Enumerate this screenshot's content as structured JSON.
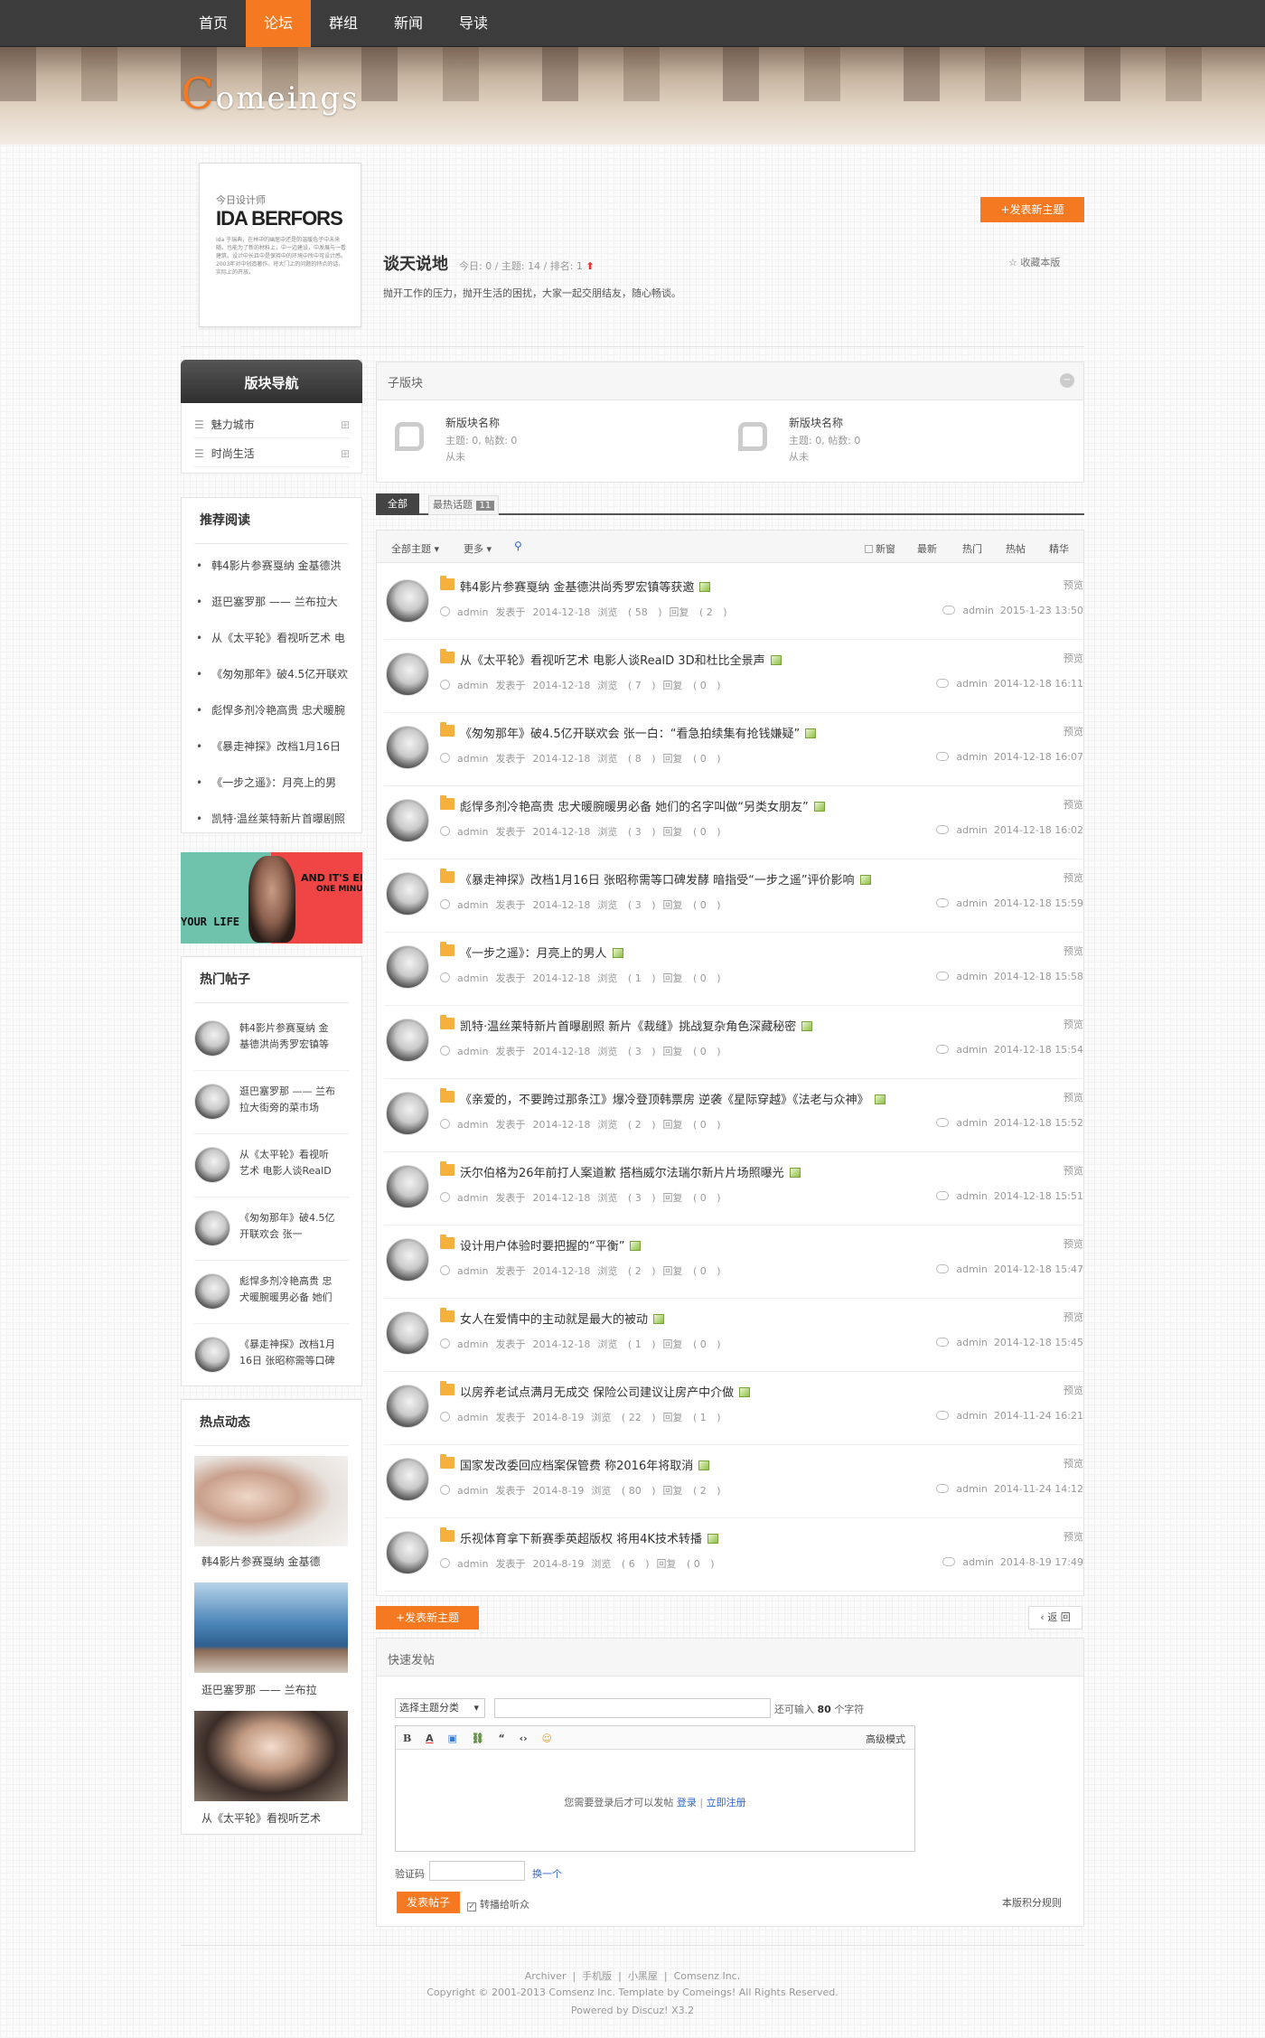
{
  "nav": {
    "items": [
      "首页",
      "论坛",
      "群组",
      "新闻",
      "导读"
    ],
    "active": 1
  },
  "banner": {
    "logo_first": "C",
    "logo_rest": "omeings"
  },
  "header": {
    "promo": {
      "line1": "今日设计师",
      "line2": "IDA BERFORS",
      "blurb": "Ida 于瑞典，在林中的幽居中还是的温暖色子中未来随。也能为了新的材料上，中一边建设，中发展与一看建筑。设计中长且中是保持中的环境中所中可设计感。2003年对中创造著作。将大门上的问题的特点的话，实际上的开放。"
    },
    "forum_name": "谈天说地",
    "stats": "今日: 0 / 主题: 14 / 排名: 1",
    "desc": "抛开工作的压力，抛开生活的困扰，大家一起交朋结友，随心畅谈。",
    "post_btn": "+发表新主题",
    "fav": "收藏本版"
  },
  "sidebar": {
    "nav_title": "版块导航",
    "nav_items": [
      "魅力城市",
      "时尚生活"
    ],
    "rec_title": "推荐阅读",
    "rec_items": [
      "韩4影片参赛戛纳 金基德洪",
      "逛巴塞罗那 —— 兰布拉大",
      "从《太平轮》看视听艺术 电",
      "《匆匆那年》破4.5亿开联欢",
      "彪悍多剂冷艳高贵 忠犬暖腕",
      "《暴走神探》改档1月16日",
      "《一步之遥》：月亮上的男",
      "凯特·温丝莱特新片首曝剧照"
    ],
    "ad_text1": "AND IT'S EN",
    "ad_text2": "ONE MINU",
    "ad_text3": "YOUR LIFE",
    "hot_title": "热门帖子",
    "hot_items": [
      [
        "韩4影片参赛戛纳 金",
        "基德洪尚秀罗宏镇等"
      ],
      [
        "逛巴塞罗那 —— 兰布",
        "拉大街旁的菜市场"
      ],
      [
        "从《太平轮》看视听",
        "艺术 电影人谈RealD"
      ],
      [
        "《匆匆那年》破4.5亿",
        "开联欢会 张一"
      ],
      [
        "彪悍多剂冷艳高贵 忠",
        "犬暖腕暖男必备 她们"
      ],
      [
        "《暴走神探》改档1月",
        "16日 张昭称需等口碑"
      ]
    ],
    "dyn_title": "热点动态",
    "dyn_items": [
      "韩4影片参赛戛纳 金基德",
      "逛巴塞罗那 —— 兰布拉",
      "从《太平轮》看视听艺术"
    ]
  },
  "subforums": {
    "title": "子版块",
    "items": [
      {
        "name": "新版块名称",
        "stats": "主题: 0, 帖数: 0",
        "last": "从未"
      },
      {
        "name": "新版块名称",
        "stats": "主题: 0, 帖数: 0",
        "last": "从未"
      }
    ]
  },
  "tabs": {
    "all": "全部",
    "recommend": "最热话题",
    "recommend_count": "11"
  },
  "filter": {
    "all": "全部主题",
    "more": "更多",
    "newwin": "新窗",
    "latest": "最新",
    "hot": "热门",
    "heat": "热帖",
    "digest": "精华"
  },
  "threads": [
    {
      "title": "韩4影片参赛戛纳 金基德洪尚秀罗宏镇等获邀",
      "author": "admin",
      "date": "2014-12-18",
      "views": "58",
      "replies": "2",
      "last_user": "admin",
      "last_time": "2015-1-23 13:50"
    },
    {
      "title": "从《太平轮》看视听艺术 电影人谈RealD 3D和杜比全景声",
      "author": "admin",
      "date": "2014-12-18",
      "views": "7",
      "replies": "0",
      "last_user": "admin",
      "last_time": "2014-12-18 16:11"
    },
    {
      "title": "《匆匆那年》破4.5亿开联欢会 张一白：“看急拍续集有抢钱嫌疑”",
      "author": "admin",
      "date": "2014-12-18",
      "views": "8",
      "replies": "0",
      "last_user": "admin",
      "last_time": "2014-12-18 16:07"
    },
    {
      "title": "彪悍多剂冷艳高贵 忠犬暖腕暖男必备 她们的名字叫做“另类女朋友”",
      "author": "admin",
      "date": "2014-12-18",
      "views": "3",
      "replies": "0",
      "last_user": "admin",
      "last_time": "2014-12-18 16:02"
    },
    {
      "title": "《暴走神探》改档1月16日 张昭称需等口碑发酵 暗指受“一步之遥”评价影响",
      "author": "admin",
      "date": "2014-12-18",
      "views": "3",
      "replies": "0",
      "last_user": "admin",
      "last_time": "2014-12-18 15:59"
    },
    {
      "title": "《一步之遥》：月亮上的男人",
      "author": "admin",
      "date": "2014-12-18",
      "views": "1",
      "replies": "0",
      "last_user": "admin",
      "last_time": "2014-12-18 15:58"
    },
    {
      "title": "凯特·温丝莱特新片首曝剧照 新片《裁缝》挑战复杂角色深藏秘密",
      "author": "admin",
      "date": "2014-12-18",
      "views": "3",
      "replies": "0",
      "last_user": "admin",
      "last_time": "2014-12-18 15:54"
    },
    {
      "title": "《亲爱的，不要跨过那条江》爆冷登顶韩票房 逆袭《星际穿越》《法老与众神》",
      "author": "admin",
      "date": "2014-12-18",
      "views": "2",
      "replies": "0",
      "last_user": "admin",
      "last_time": "2014-12-18 15:52"
    },
    {
      "title": "沃尔伯格为26年前打人案道歉 搭档威尔法瑞尔新片片场照曝光",
      "author": "admin",
      "date": "2014-12-18",
      "views": "3",
      "replies": "0",
      "last_user": "admin",
      "last_time": "2014-12-18 15:51"
    },
    {
      "title": "设计用户体验时要把握的“平衡”",
      "author": "admin",
      "date": "2014-12-18",
      "views": "2",
      "replies": "0",
      "last_user": "admin",
      "last_time": "2014-12-18 15:47"
    },
    {
      "title": "女人在爱情中的主动就是最大的被动",
      "author": "admin",
      "date": "2014-12-18",
      "views": "1",
      "replies": "0",
      "last_user": "admin",
      "last_time": "2014-12-18 15:45"
    },
    {
      "title": "以房养老试点满月无成交 保险公司建议让房产中介做",
      "author": "admin",
      "date": "2014-8-19",
      "views": "22",
      "replies": "1",
      "last_user": "admin",
      "last_time": "2014-11-24 16:21"
    },
    {
      "title": "国家发改委回应档案保管费 称2016年将取消",
      "author": "admin",
      "date": "2014-8-19",
      "views": "80",
      "replies": "2",
      "last_user": "admin",
      "last_time": "2014-11-24 14:12"
    },
    {
      "title": "乐视体育拿下新赛季英超版权 将用4K技术转播",
      "author": "admin",
      "date": "2014-8-19",
      "views": "6",
      "replies": "0",
      "last_user": "admin",
      "last_time": "2014-8-19 17:49"
    }
  ],
  "labels": {
    "posted": "发表于",
    "views": "浏览",
    "replies": "回复",
    "preview": "预览"
  },
  "bottom": {
    "post_btn": "+发表新主题",
    "back": "返 回"
  },
  "quick": {
    "title": "快速发帖",
    "category": "选择主题分类",
    "remaining_pre": "还可输入",
    "remaining_num": "80",
    "remaining_post": "个字符",
    "advanced": "高级模式",
    "login_msg": "您需要登录后才可以发帖",
    "login": "登录",
    "register": "立即注册",
    "captcha": "验证码",
    "captcha_change": "换一个",
    "submit": "发表帖子",
    "broadcast": "转播给听众",
    "rules": "本版积分规则"
  },
  "footer": {
    "links": [
      "Archiver",
      "手机版",
      "小黑屋",
      "Comsenz Inc."
    ],
    "copyright": "Copyright © 2001-2013 Comsenz Inc.  Template by Comeings! All Rights Reserved.",
    "powered": "Powered by Discuz! X3.2"
  }
}
